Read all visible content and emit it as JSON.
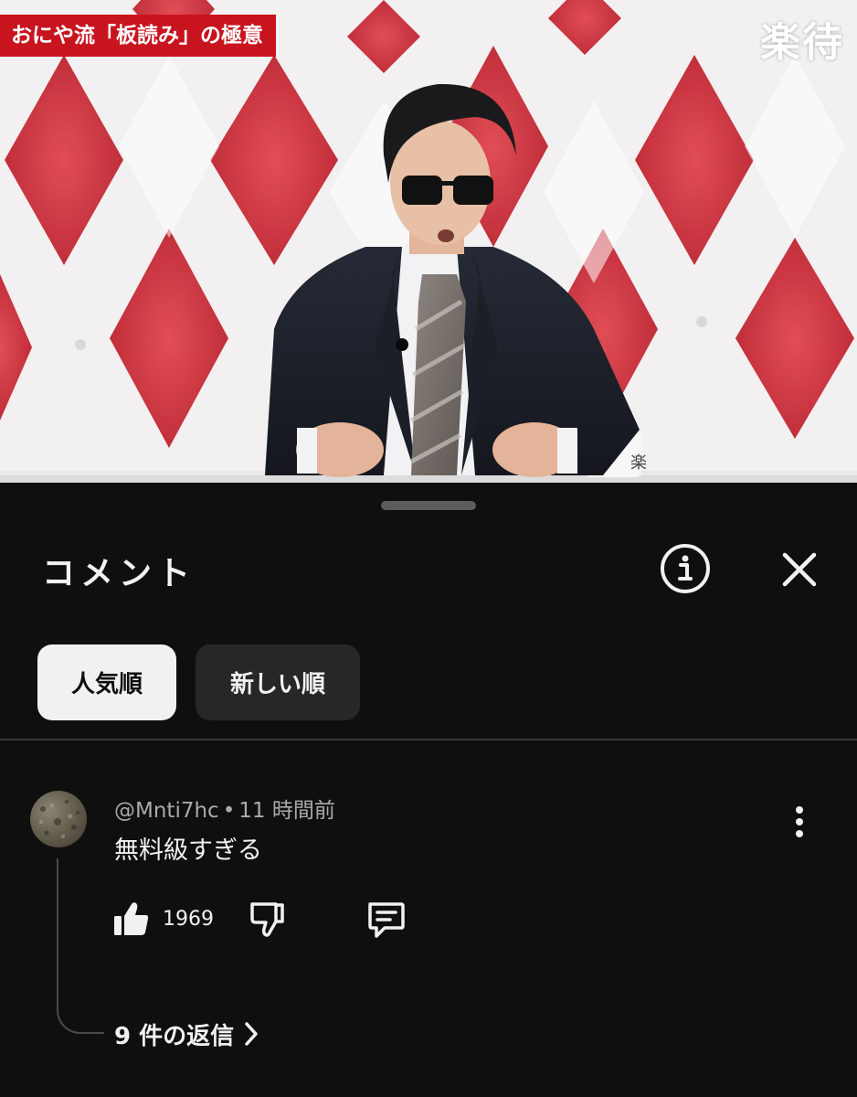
{
  "video": {
    "title_banner": "おにや流「板読み」の極意",
    "channel_logo": "楽待",
    "mug_text": "楽"
  },
  "comments_panel": {
    "title": "コメント",
    "info_icon": "info-icon",
    "close_icon": "close-icon",
    "sort_chips": [
      {
        "label": "人気順",
        "selected": true
      },
      {
        "label": "新しい順",
        "selected": false
      }
    ]
  },
  "comment": {
    "author": "@Mnti7hc",
    "separator": "•",
    "time": "11 時間前",
    "text": "無料級すぎる",
    "like_count": "1969",
    "icons": {
      "like": "thumbs-up-icon",
      "dislike": "thumbs-down-icon",
      "reply": "reply-icon",
      "more": "more-vertical-icon"
    },
    "replies_label": "9 件の返信"
  },
  "colors": {
    "background": "#0f0f0f",
    "chip_selected_bg": "#f1f1f1",
    "chip_bg": "#272727",
    "banner_red": "#c8141e",
    "secondary_text": "#aaaaaa"
  }
}
